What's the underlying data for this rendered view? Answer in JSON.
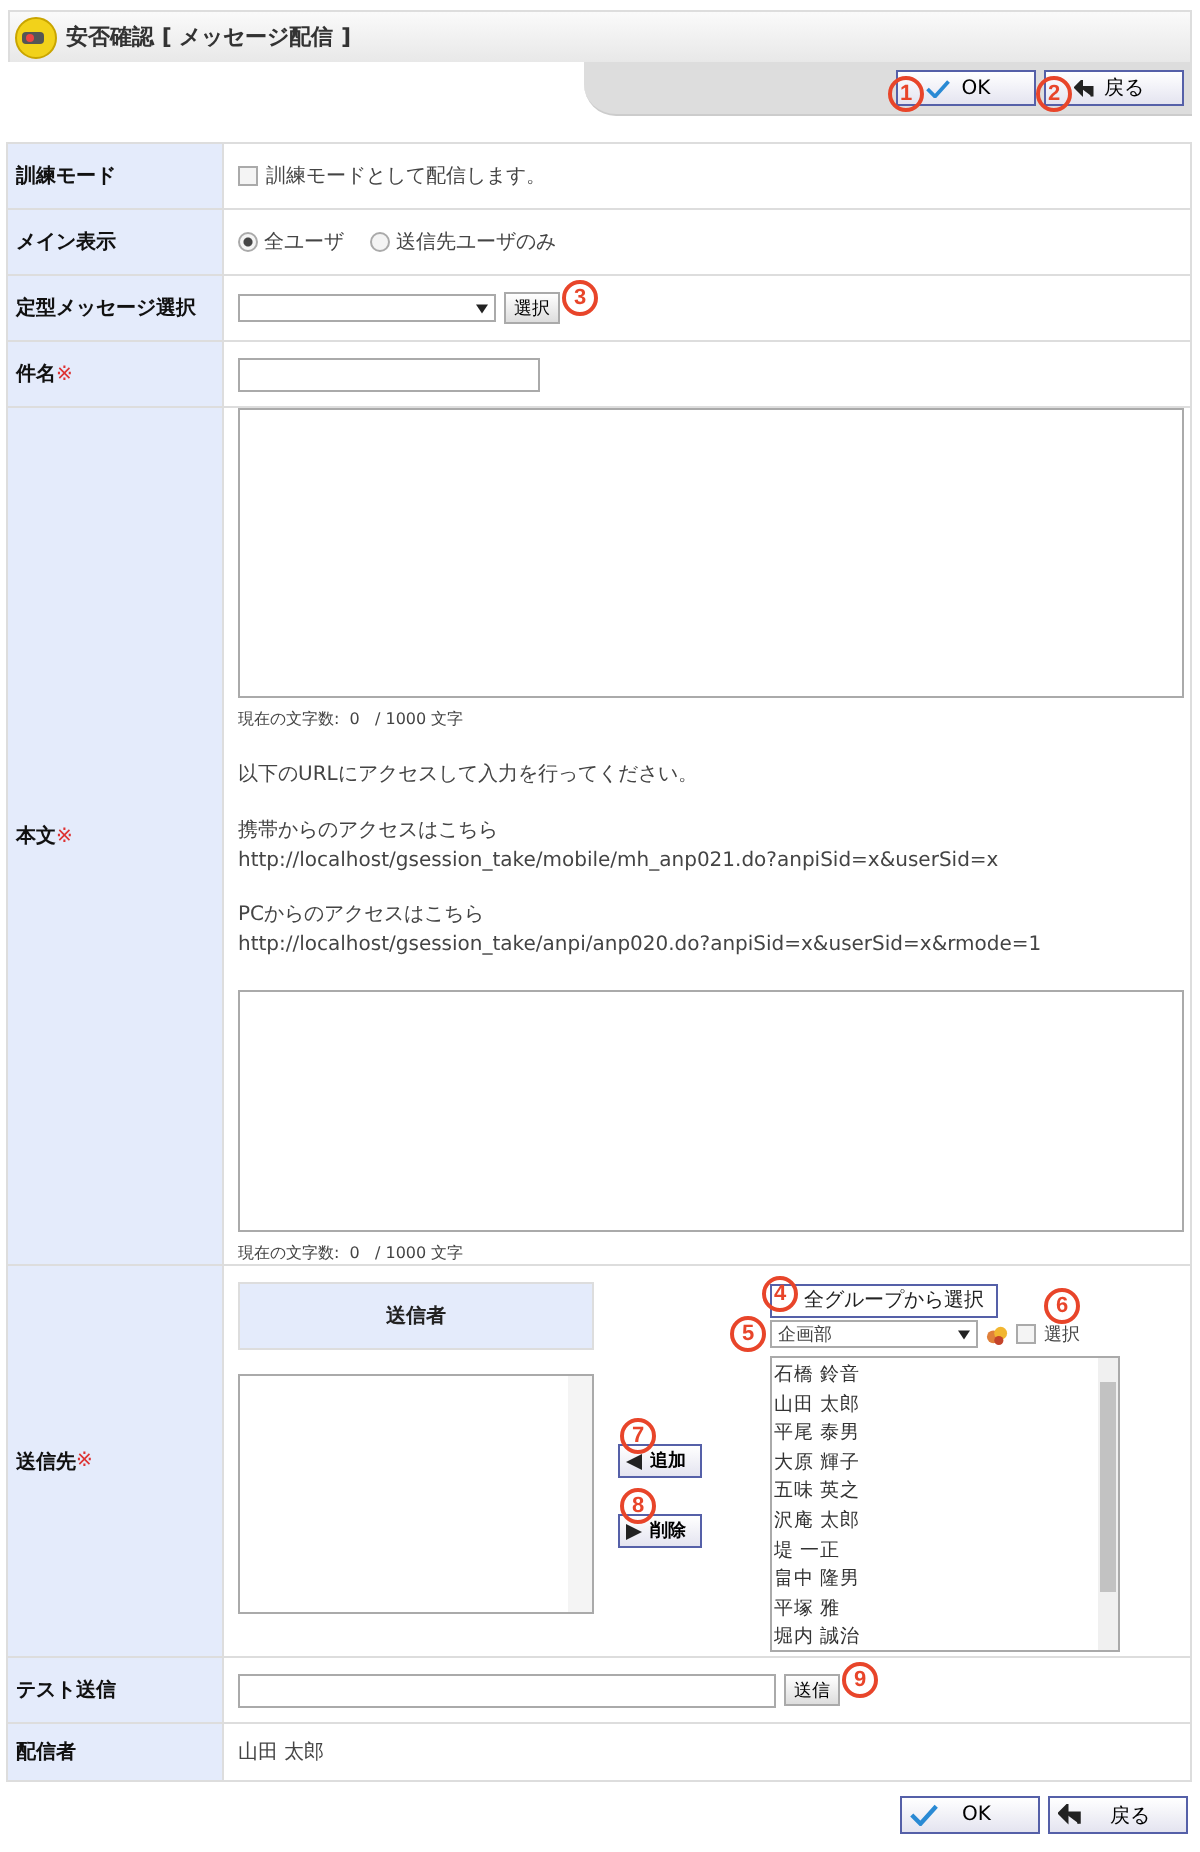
{
  "title": "安否確認 [ メッセージ配信 ]",
  "top_buttons": [
    {
      "label": "OK",
      "kind": "ok",
      "marker": "1"
    },
    {
      "label": "戻る",
      "kind": "back",
      "marker": "2"
    }
  ],
  "rows": [
    {
      "label": "訓練モード",
      "kind": "checkbox",
      "checkbox": {
        "label": "訓練モードとして配信します。",
        "checked": false
      }
    },
    {
      "label": "メイン表示",
      "kind": "radios",
      "options": [
        {
          "label": "全ユーザ",
          "selected": true
        },
        {
          "label": "送信先ユーザのみ",
          "selected": false
        }
      ]
    },
    {
      "label": "定型メッセージ選択",
      "kind": "select",
      "button": "選択",
      "marker": "3"
    },
    {
      "label": "件名",
      "kind": "text",
      "mark": "※"
    },
    {
      "label": "本文",
      "kind": "body",
      "mark": "※",
      "counter_1": "現在の文字数:  0   / 1000 文字",
      "paragraphs": [
        [
          "以下のURLにアクセスして入力を行ってください。"
        ],
        [
          "携帯からのアクセスはこちら",
          "http://localhost/gsession_take/mobile/mh_anp021.do?anpiSid=x&userSid=x"
        ],
        [
          "PCからのアクセスはこちら",
          "http://localhost/gsession_take/anpi/anp020.do?anpiSid=x&userSid=x&rmode=1"
        ]
      ],
      "counter_2": "現在の文字数:  0   / 1000 文字"
    },
    {
      "label": "送信先",
      "kind": "recipients",
      "mark": "※",
      "header": "送信者",
      "add": {
        "label": "追加",
        "marker": "7"
      },
      "remove": {
        "label": "削除",
        "marker": "8"
      },
      "group_link": {
        "label": "全グループから選択",
        "marker": "4"
      },
      "group_select": {
        "value": "企画部",
        "marker": "5"
      },
      "select_check": {
        "label": "選択",
        "checked": false,
        "marker": "6"
      },
      "members": [
        "石橋 鈴音",
        "山田 太郎",
        "平尾 泰男",
        "大原 輝子",
        "五味 英之",
        "沢庵 太郎",
        "堤 一正",
        "畠中 隆男",
        "平塚 雅",
        "堀内 誠治"
      ]
    },
    {
      "label": "テスト送信",
      "kind": "test",
      "button": "送信",
      "marker": "9"
    },
    {
      "label": "配信者",
      "kind": "plain",
      "value": "山田 太郎"
    }
  ],
  "bottom_buttons": [
    {
      "label": "OK",
      "kind": "ok"
    },
    {
      "label": "戻る",
      "kind": "back"
    }
  ]
}
